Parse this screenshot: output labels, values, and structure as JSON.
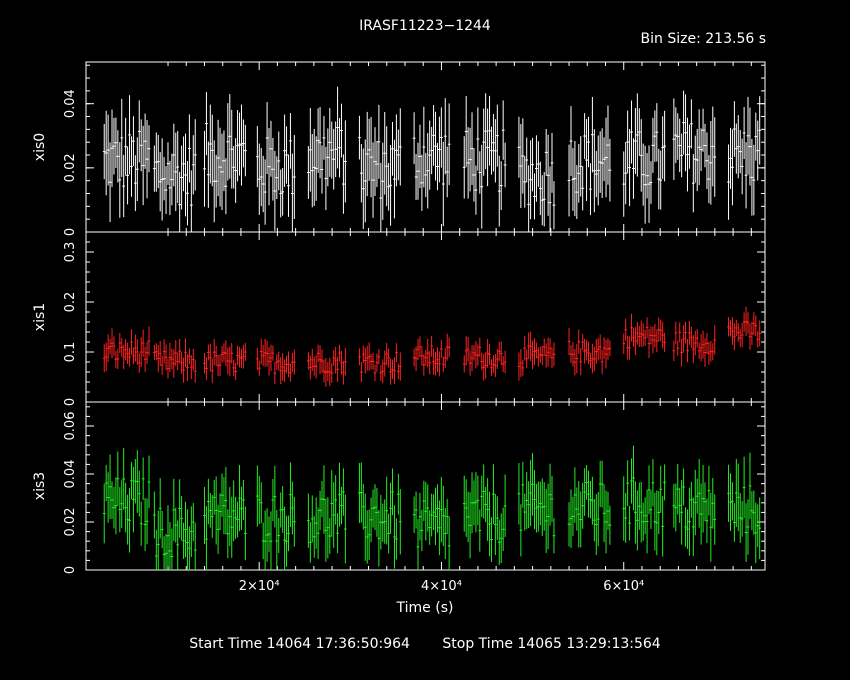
{
  "header": {
    "title": "IRASF11223−1244",
    "bin_size": "Bin Size: 213.56 s"
  },
  "footer": {
    "start_time": "Start Time 14064 17:36:50:964",
    "stop_time": "Stop Time 14065 13:29:13:564"
  },
  "chart_data": {
    "type": "scatter",
    "title": "IRASF11223−1244",
    "xlabel": "Time (s)",
    "xlim": [
      1000,
      75500
    ],
    "x_ticks": [
      20000,
      40000,
      60000
    ],
    "x_tick_labels": [
      "2×10⁴",
      "4×10⁴",
      "6×10⁴"
    ],
    "segments": [
      [
        3000,
        8000
      ],
      [
        8500,
        13000
      ],
      [
        14000,
        18500
      ],
      [
        19800,
        24000
      ],
      [
        25400,
        29500
      ],
      [
        31000,
        35500
      ],
      [
        37000,
        41000
      ],
      [
        42500,
        47000
      ],
      [
        48500,
        52500
      ],
      [
        54000,
        58500
      ],
      [
        60000,
        64500
      ],
      [
        65500,
        70000
      ],
      [
        71500,
        75000
      ]
    ],
    "series": [
      {
        "name": "xis0",
        "color": "#ffffff",
        "ylim": [
          0,
          0.053
        ],
        "y_ticks": [
          0,
          0.02,
          0.04
        ],
        "y_tick_labels": [
          "0",
          "0.02",
          "0.04"
        ],
        "typical": [
          0.022,
          0.018,
          0.024,
          0.02,
          0.024,
          0.02,
          0.024,
          0.022,
          0.018,
          0.022,
          0.022,
          0.025,
          0.024
        ],
        "err": 0.011
      },
      {
        "name": "xis1",
        "color": "#ff2020",
        "ylim": [
          0,
          0.34
        ],
        "y_ticks": [
          0,
          0.1,
          0.2,
          0.3
        ],
        "y_tick_labels": [
          "0",
          "0.1",
          "0.2",
          "0.3"
        ],
        "typical": [
          0.1,
          0.08,
          0.08,
          0.08,
          0.08,
          0.08,
          0.09,
          0.09,
          0.09,
          0.1,
          0.13,
          0.12,
          0.14
        ],
        "err": 0.025
      },
      {
        "name": "xis3",
        "color": "#22ee22",
        "ylim": [
          0,
          0.07
        ],
        "y_ticks": [
          0,
          0.02,
          0.04,
          0.06
        ],
        "y_tick_labels": [
          "0",
          "0.02",
          "0.04",
          "0.06"
        ],
        "typical": [
          0.028,
          0.016,
          0.022,
          0.022,
          0.022,
          0.022,
          0.018,
          0.022,
          0.025,
          0.026,
          0.028,
          0.025,
          0.025
        ],
        "err": 0.012
      }
    ]
  }
}
